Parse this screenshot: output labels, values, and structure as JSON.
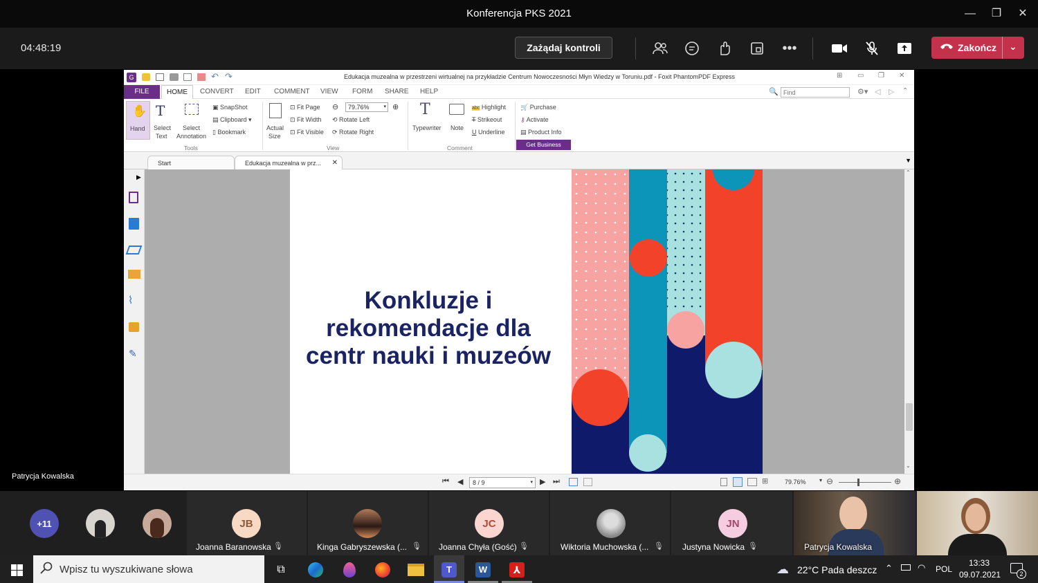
{
  "teams": {
    "window_title": "Konferencja PKS 2021",
    "timer": "04:48:19",
    "request_control": "Zażądaj kontroli",
    "end_call": "Zakończ",
    "presenter_name": "Patrycja Kowalska"
  },
  "foxit": {
    "doc_title": "Edukacja muzealna w przestrzeni wirtualnej na przykładzie Centrum Nowoczesności Młyn Wiedzy w Toruniu.pdf - Foxit PhantomPDF Express",
    "menu": [
      "FILE",
      "HOME",
      "CONVERT",
      "EDIT",
      "COMMENT",
      "VIEW",
      "FORM",
      "SHARE",
      "HELP"
    ],
    "find_placeholder": "Find",
    "ribbon": {
      "hand": "Hand",
      "select_text": [
        "Select",
        "Text"
      ],
      "select_annotation": [
        "Select",
        "Annotation"
      ],
      "snapshot": "SnapShot",
      "clipboard": "Clipboard",
      "bookmark": "Bookmark",
      "tools_group": "Tools",
      "actual_size": [
        "Actual",
        "Size"
      ],
      "fit_page": "Fit Page",
      "fit_width": "Fit Width",
      "fit_visible": "Fit Visible",
      "zoom": "79.76%",
      "rotate_left": "Rotate Left",
      "rotate_right": "Rotate Right",
      "view_group": "View",
      "typewriter": "Typewriter",
      "note": "Note",
      "highlight": "Highlight",
      "strikeout": "Strikeout",
      "underline": "Underline",
      "comment_group": "Comment",
      "purchase": "Purchase",
      "activate": "Activate",
      "product_info": "Product Info",
      "get_business": "Get Business"
    },
    "tabs": [
      "Start",
      "Edukacja muzealna w prz..."
    ],
    "slide_lines": [
      "Konkluzje i",
      "rekomendacje dla",
      "centr nauki i muzeów"
    ],
    "page_indicator": "8 / 9",
    "status_zoom": "79.76%"
  },
  "gallery": {
    "overflow": "+11",
    "participants": [
      {
        "initials": "JB",
        "name": "Joanna Baranowska",
        "color": "#f7d9c4"
      },
      {
        "initials": "",
        "name": "Kinga Gabryszewska (...",
        "color": "#7a5c4a"
      },
      {
        "initials": "JC",
        "name": "Joanna Chyła (Gość)",
        "color": "#fbd5cf"
      },
      {
        "initials": "",
        "name": "Wiktoria Muchowska (...",
        "color": "#bbb"
      },
      {
        "initials": "JN",
        "name": "Justyna Nowicka",
        "color": "#f4cde0"
      },
      {
        "initials": "",
        "name": "Patrycja Kowalska",
        "color": "#4a4036"
      }
    ]
  },
  "taskbar": {
    "search_placeholder": "Wpisz tu wyszukiwane słowa",
    "weather": "22°C  Pada deszcz",
    "lang": "POL",
    "time": "13:33",
    "date": "09.07.2021",
    "notifications": "2"
  }
}
